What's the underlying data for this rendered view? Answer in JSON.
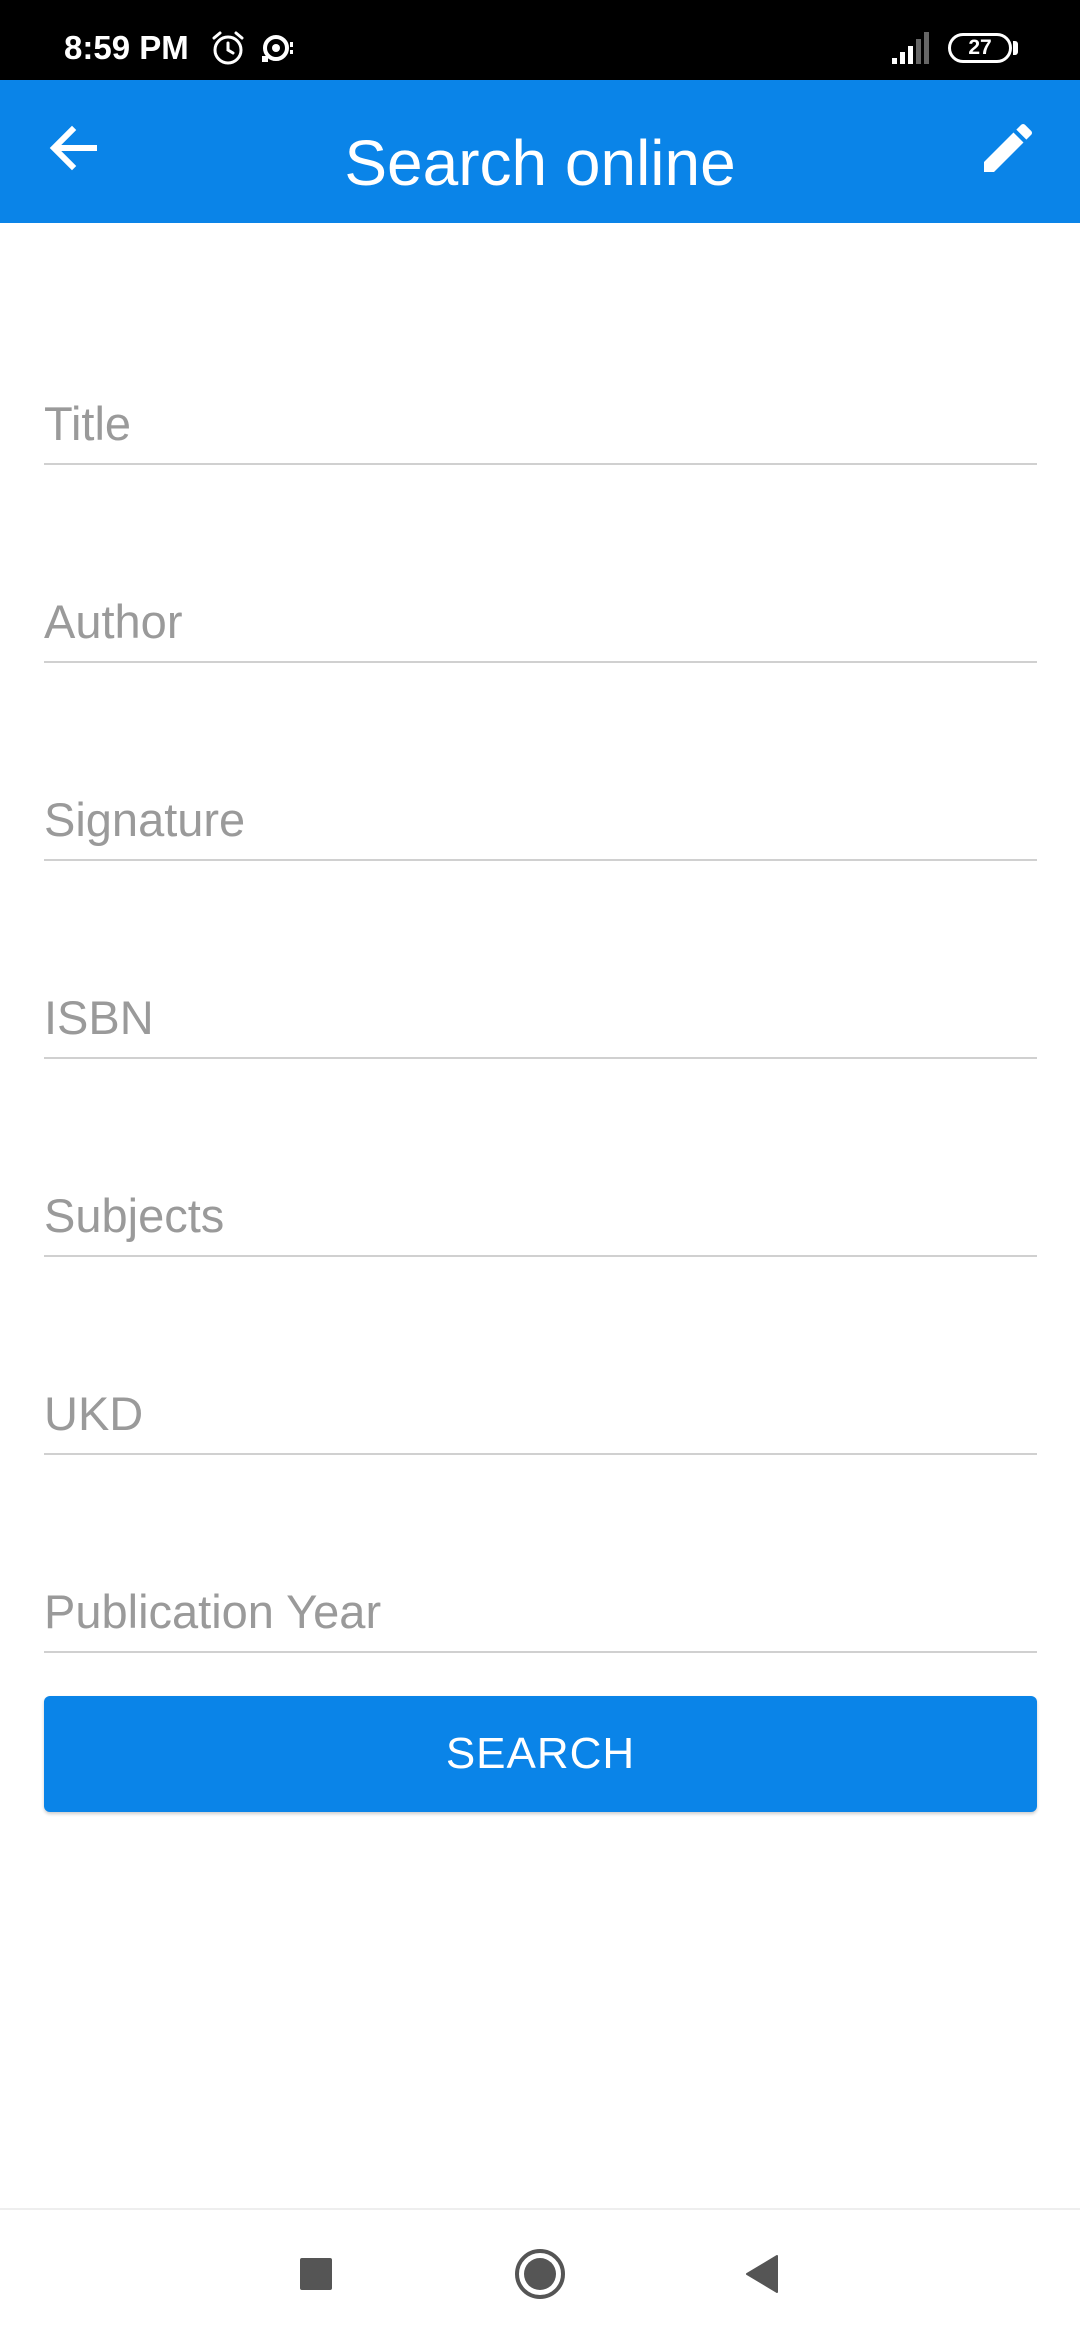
{
  "status_bar": {
    "time": "8:59 PM",
    "battery": "27",
    "icons": [
      "alarm-icon",
      "sync-icon",
      "signal-icon",
      "battery-icon"
    ]
  },
  "app_bar": {
    "title": "Search online",
    "back_icon": "back-arrow-icon",
    "edit_icon": "pencil-icon"
  },
  "form": {
    "fields": [
      {
        "placeholder": "Title",
        "value": ""
      },
      {
        "placeholder": "Author",
        "value": ""
      },
      {
        "placeholder": "Signature",
        "value": ""
      },
      {
        "placeholder": "ISBN",
        "value": ""
      },
      {
        "placeholder": "Subjects",
        "value": ""
      },
      {
        "placeholder": "UKD",
        "value": ""
      },
      {
        "placeholder": "Publication Year",
        "value": ""
      }
    ],
    "search_label": "SEARCH"
  },
  "nav_bar": {
    "icons": [
      "recents-square-icon",
      "home-circle-icon",
      "back-triangle-icon"
    ]
  },
  "colors": {
    "accent": "#0A84E8",
    "status_bar": "#000000",
    "placeholder": "#9a9a9a",
    "underline": "#d0d0d0"
  }
}
